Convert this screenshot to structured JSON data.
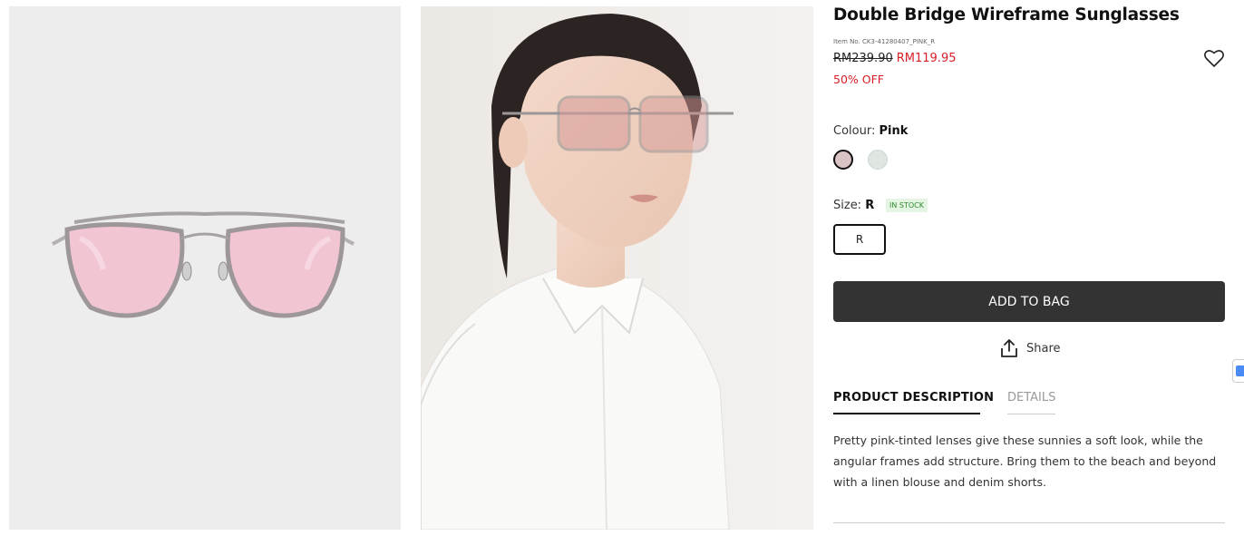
{
  "product": {
    "title": "Double Bridge Wireframe Sunglasses",
    "item_no": "Item No. CK3-41280407_PINK_R",
    "original_price": "RM239.90",
    "sale_price": "RM119.95",
    "discount": "50% OFF"
  },
  "colour": {
    "label": "Colour:",
    "selected": "Pink",
    "swatches": [
      {
        "name": "Pink",
        "color": "#d9c3c5"
      },
      {
        "name": "Green",
        "color": "#dfe6df"
      }
    ]
  },
  "size": {
    "label": "Size:",
    "selected": "R",
    "stock": "IN STOCK",
    "options": [
      "R"
    ]
  },
  "actions": {
    "add_to_bag": "ADD TO BAG",
    "share": "Share"
  },
  "tabs": [
    {
      "label": "PRODUCT DESCRIPTION",
      "active": true
    },
    {
      "label": "DETAILS",
      "active": false
    }
  ],
  "description": "Pretty pink-tinted lenses give these sunnies a soft look, while the angular frames add structure. Bring them to the beach and beyond with a linen blouse and denim shorts.",
  "icons": {
    "wishlist": "heart-icon",
    "share": "share-icon"
  },
  "colors": {
    "sale": "#d81f26",
    "button": "#333333",
    "stock_badge": "#2b8a2b"
  }
}
